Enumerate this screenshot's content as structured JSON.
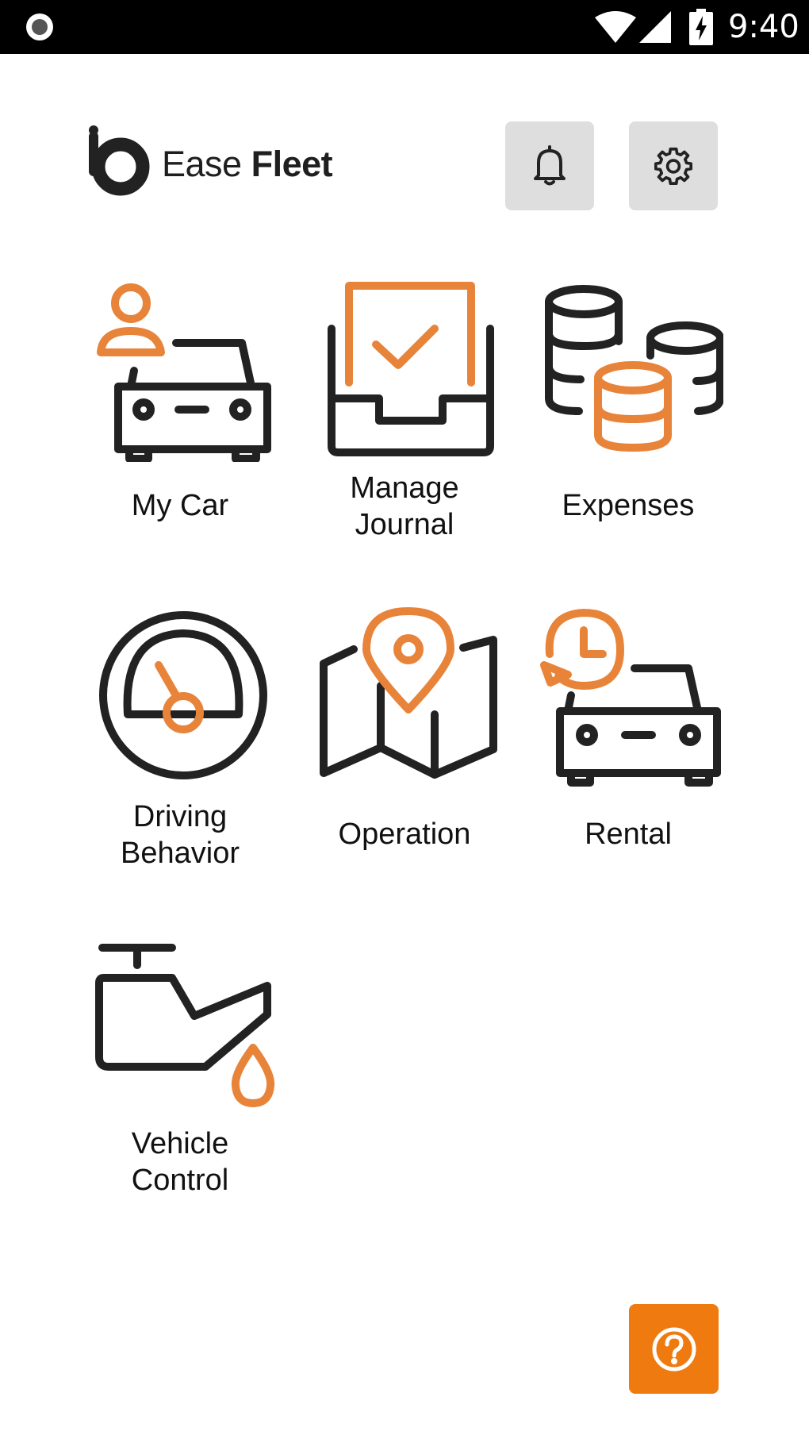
{
  "status_bar": {
    "time": "9:40"
  },
  "header": {
    "logo_text_light": "Ease ",
    "logo_text_bold": "Fleet",
    "notifications_icon": "bell-icon",
    "settings_icon": "gear-icon"
  },
  "tiles": [
    {
      "label": "My Car",
      "icon": "car-with-person-icon"
    },
    {
      "label": "Manage Journal",
      "icon": "journal-inbox-check-icon"
    },
    {
      "label": "Expenses",
      "icon": "coin-stacks-icon"
    },
    {
      "label": "Driving Behavior",
      "icon": "speedometer-icon"
    },
    {
      "label": "Operation",
      "icon": "map-pin-icon"
    },
    {
      "label": "Rental",
      "icon": "car-with-clock-icon"
    },
    {
      "label": "Vehicle Control",
      "icon": "oil-can-icon"
    }
  ],
  "help_button": {
    "icon": "help-question-icon"
  },
  "colors": {
    "accent": "#e8843a",
    "dark": "#222222",
    "help_bg": "#ef7b10",
    "button_bg": "#dedede"
  }
}
